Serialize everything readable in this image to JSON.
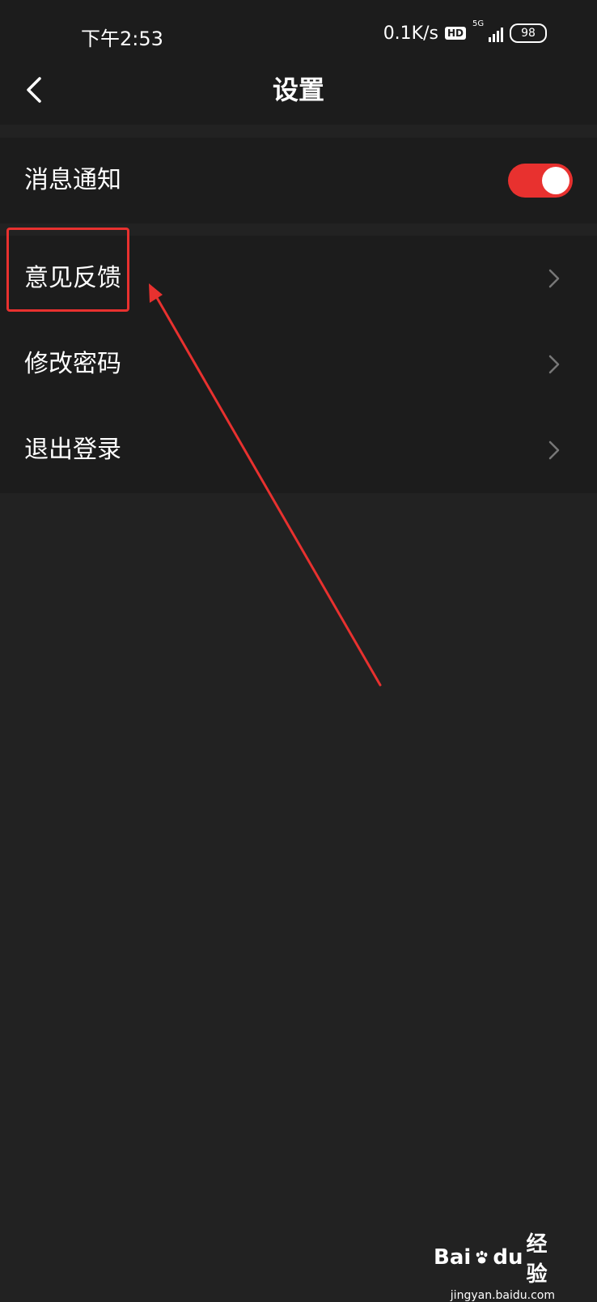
{
  "status_bar": {
    "time": "下午2:53",
    "speed": "0.1K/s",
    "hd": "HD",
    "network": "5G",
    "battery": "98"
  },
  "header": {
    "title": "设置"
  },
  "settings": {
    "notification_label": "消息通知",
    "notification_enabled": true,
    "feedback_label": "意见反馈",
    "change_password_label": "修改密码",
    "logout_label": "退出登录"
  },
  "watermark": {
    "brand": "Bai",
    "brand2": "du",
    "jingyan": "经验",
    "url": "jingyan.baidu.com"
  },
  "colors": {
    "accent": "#e8312f",
    "background": "#222222",
    "panel": "#1c1c1c",
    "text": "#ffffff",
    "chevron": "#777777"
  }
}
